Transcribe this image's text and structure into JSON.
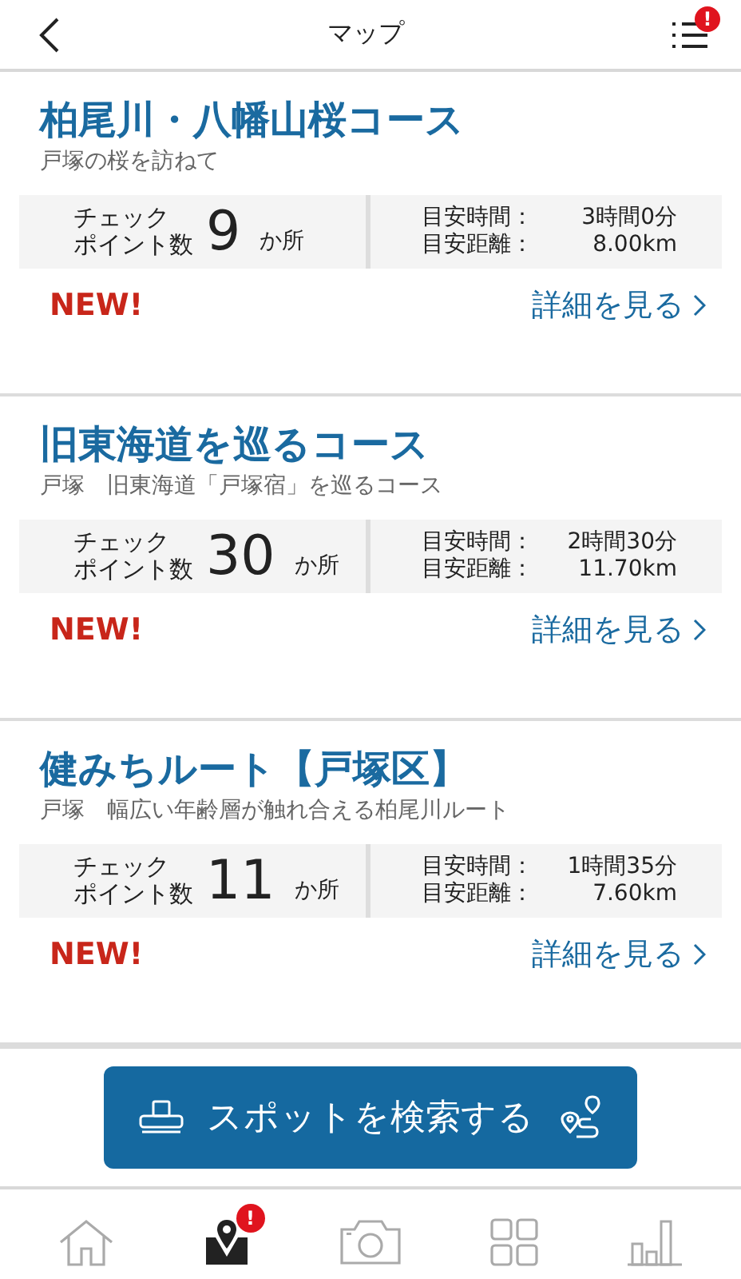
{
  "header": {
    "title": "マップ",
    "menu_badge": "!"
  },
  "courses": [
    {
      "title": "柏尾川・八幡山桜コース",
      "subtitle": "戸塚の桜を訪ねて",
      "checkpoint_label_1": "チェック",
      "checkpoint_label_2": "ポイント数",
      "checkpoint_count": "9",
      "checkpoint_unit": "か所",
      "time_label": "目安時間：",
      "time": "3時間0分",
      "distance_label": "目安距離：",
      "distance": "8.00km",
      "is_new": true,
      "new_label": "NEW!",
      "link": "詳細を見る"
    },
    {
      "title": "旧東海道を巡るコース",
      "subtitle": "戸塚　旧東海道「戸塚宿」を巡るコース",
      "checkpoint_label_1": "チェック",
      "checkpoint_label_2": "ポイント数",
      "checkpoint_count": "30",
      "checkpoint_unit": "か所",
      "time_label": "目安時間：",
      "time": "2時間30分",
      "distance_label": "目安距離：",
      "distance": "11.70km",
      "is_new": true,
      "new_label": "NEW!",
      "link": "詳細を見る"
    },
    {
      "title": "健みちルート【戸塚区】",
      "subtitle": "戸塚　幅広い年齢層が触れ合える柏尾川ルート",
      "checkpoint_label_1": "チェック",
      "checkpoint_label_2": "ポイント数",
      "checkpoint_count": "11",
      "checkpoint_unit": "か所",
      "time_label": "目安時間：",
      "time": "1時間35分",
      "distance_label": "目安距離：",
      "distance": "7.60km",
      "is_new": true,
      "new_label": "NEW!",
      "link": "詳細を見る"
    }
  ],
  "search_button": {
    "label": "スポットを検索する"
  },
  "tabs": [
    {
      "kind": "home",
      "selected": false
    },
    {
      "kind": "map",
      "selected": true,
      "badge": "!"
    },
    {
      "kind": "camera",
      "selected": false
    },
    {
      "kind": "grid",
      "selected": false
    },
    {
      "kind": "chart",
      "selected": false
    }
  ]
}
